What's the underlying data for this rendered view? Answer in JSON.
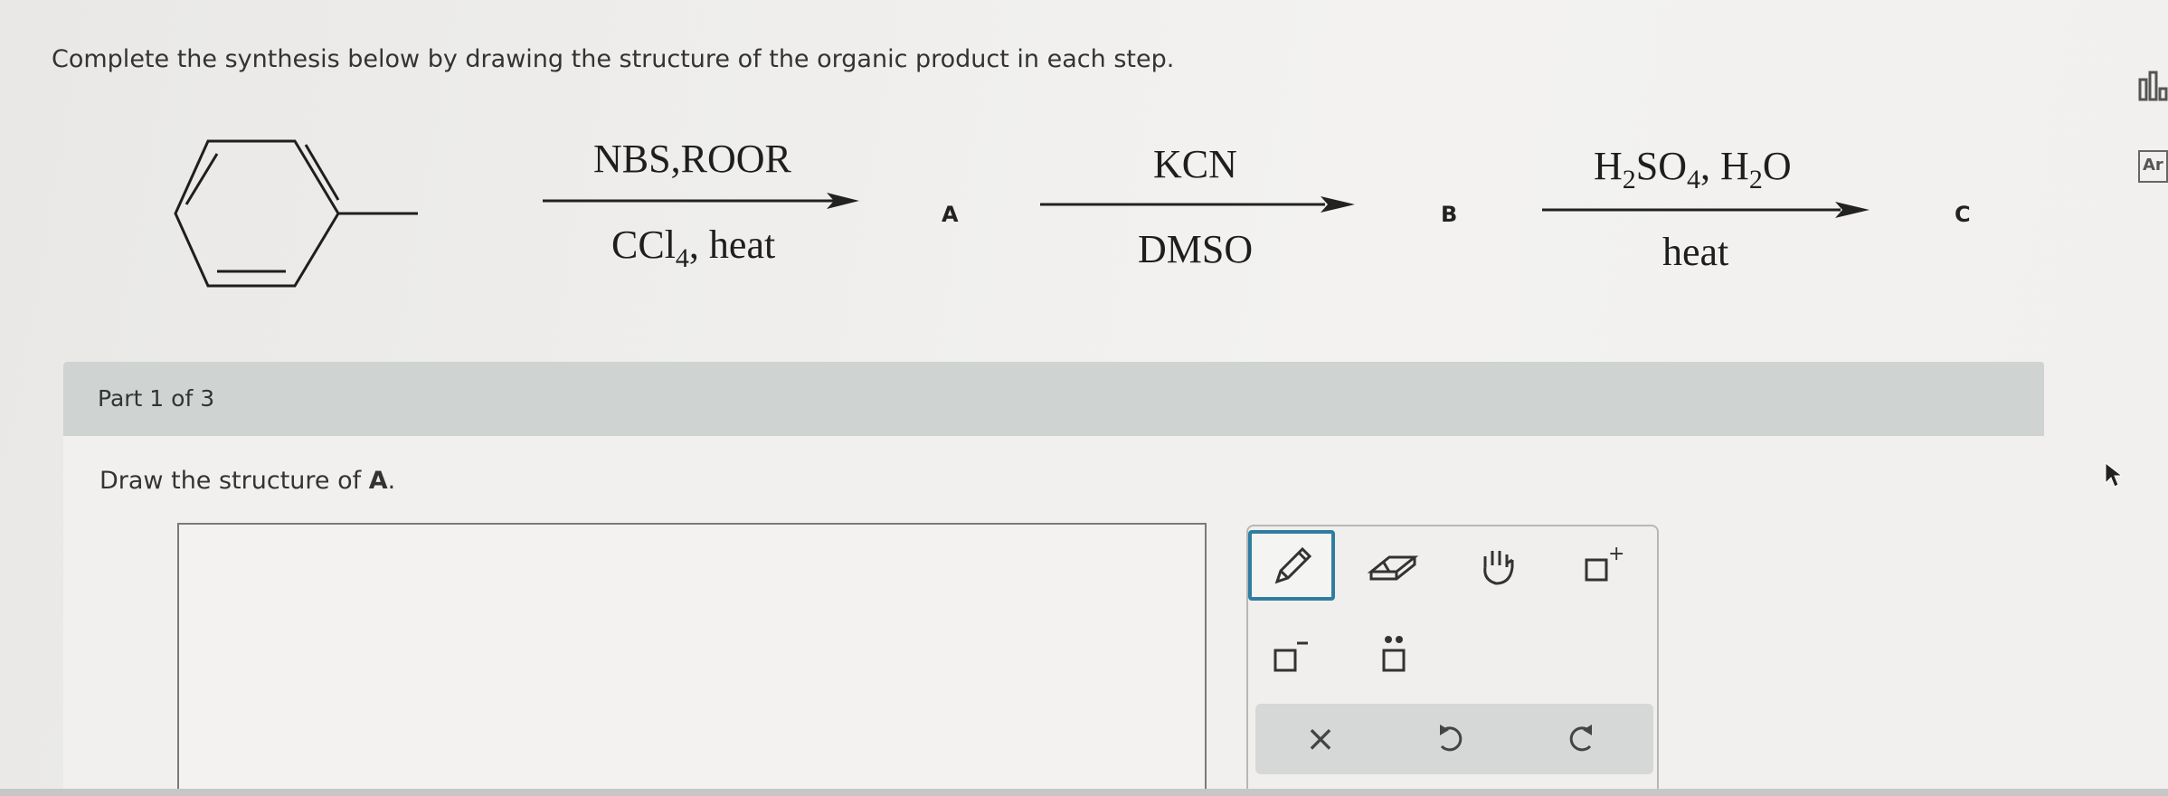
{
  "question": {
    "instruction": "Complete the synthesis below by drawing the structure of the organic product in each step."
  },
  "scheme": {
    "step1": {
      "above": "NBS,ROOR",
      "below_main": "CCl",
      "below_sub": "4",
      "below_rest": ", heat"
    },
    "label_a": "A",
    "step2": {
      "above": "KCN",
      "below": "DMSO"
    },
    "label_b": "B",
    "step3": {
      "above_h": "H",
      "above_sub1": "2",
      "above_so": "SO",
      "above_sub2": "4",
      "above_comma": ", H",
      "above_sub3": "2",
      "above_o": "O",
      "below": "heat"
    },
    "label_c": "C"
  },
  "part": {
    "title": "Part 1 of 3",
    "prompt_prefix": "Draw the structure of ",
    "prompt_bold": "A",
    "prompt_suffix": "."
  },
  "side": {
    "ar_label": "Ar"
  },
  "toolbar": {
    "tools": [
      "pencil-tool",
      "eraser-tool",
      "hand-tool",
      "positive-charge-tool",
      "negative-charge-tool",
      "lone-pair-tool"
    ],
    "actions": [
      "clear",
      "undo",
      "redo"
    ],
    "clear_glyph": "×",
    "charge_plus": "+",
    "charge_minus": "−"
  },
  "colors": {
    "header_band": "#cfd3d2",
    "active_tool_border": "#2f7ea2"
  }
}
